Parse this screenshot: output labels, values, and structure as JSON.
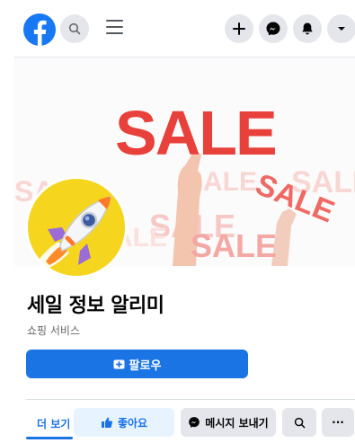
{
  "header": {
    "logo": "facebook-logo",
    "icons": [
      "search-icon",
      "menu-icon",
      "plus-icon",
      "messenger-icon",
      "bell-icon",
      "chevron-down-icon"
    ]
  },
  "cover": {
    "sale_text": "SALE"
  },
  "page": {
    "name": "세일 정보 알리미",
    "category": "쇼핑 서비스",
    "follow_label": "팔로우"
  },
  "actions": {
    "more_tab": "더 보기",
    "like_label": "좋아요",
    "message_label": "메시지 보내기",
    "more_glyph": "···"
  },
  "colors": {
    "accent": "#1b74e4",
    "sale_red": "#e8403a",
    "avatar_bg": "#f6d51e"
  }
}
